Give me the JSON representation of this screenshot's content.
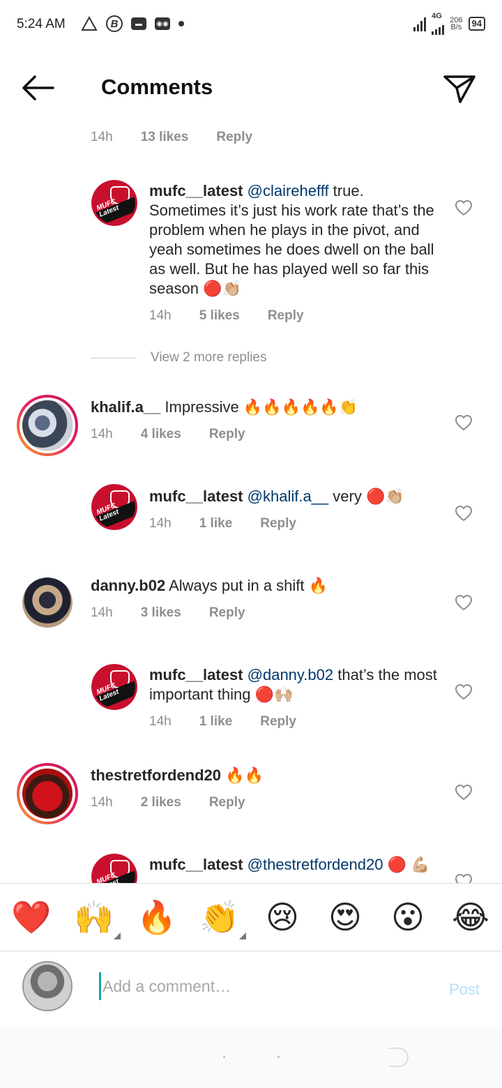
{
  "status_bar": {
    "time": "5:24 AM",
    "network_type": "4G",
    "speed_value": "206",
    "speed_unit": "B/s",
    "battery": "94",
    "icons": [
      "warning-icon",
      "b-circle-icon",
      "message-icon",
      "gamepad-icon",
      "dot-icon",
      "signal-icon",
      "signal-4g-icon",
      "battery-icon"
    ]
  },
  "header": {
    "title": "Comments",
    "back_icon": "arrow-left-icon",
    "share_icon": "paper-plane-icon"
  },
  "top_meta": {
    "time": "14h",
    "likes": "13 likes",
    "reply": "Reply"
  },
  "comments": [
    {
      "username": "mufc__latest",
      "mention": "@clairehefff",
      "text": " true. Sometimes it’s just his work rate that’s the problem when he plays in the pivot, and yeah sometimes he does dwell on the ball as well. But he has played well so far this season 🔴👏🏼",
      "time": "14h",
      "likes": "5 likes",
      "reply": "Reply",
      "is_reply": true
    },
    {
      "username": "khalif.a__",
      "mention": "",
      "text": " Impressive 🔥🔥🔥🔥🔥👏",
      "time": "14h",
      "likes": "4 likes",
      "reply": "Reply",
      "is_reply": false
    },
    {
      "username": "mufc__latest",
      "mention": "@khalif.a__",
      "text": " very 🔴👏🏼",
      "time": "14h",
      "likes": "1 like",
      "reply": "Reply",
      "is_reply": true
    },
    {
      "username": "danny.b02",
      "mention": "",
      "text": " Always put in a shift 🔥",
      "time": "14h",
      "likes": "3 likes",
      "reply": "Reply",
      "is_reply": false
    },
    {
      "username": "mufc__latest",
      "mention": "@danny.b02",
      "text": " that’s the most important thing 🔴🙌🏼",
      "time": "14h",
      "likes": "1 like",
      "reply": "Reply",
      "is_reply": true
    },
    {
      "username": "thestretfordend20",
      "mention": "",
      "text": " 🔥🔥",
      "time": "14h",
      "likes": "2 likes",
      "reply": "Reply",
      "is_reply": false
    },
    {
      "username": "mufc__latest",
      "mention": "@thestretfordend20",
      "text": " 🔴 💪🏼",
      "time": "",
      "likes": "",
      "reply": "",
      "is_reply": true
    }
  ],
  "view_more": "View 2 more replies",
  "emoji_bar": [
    "❤️",
    "🙌",
    "🔥",
    "👏",
    "😢",
    "😍",
    "😮",
    "😂"
  ],
  "composer": {
    "placeholder": "Add a comment…",
    "post_label": "Post"
  },
  "colors": {
    "mention": "#00376b",
    "meta": "#8e8e8e",
    "post_disabled": "#b2dffc",
    "logo_red": "#c8102e"
  }
}
